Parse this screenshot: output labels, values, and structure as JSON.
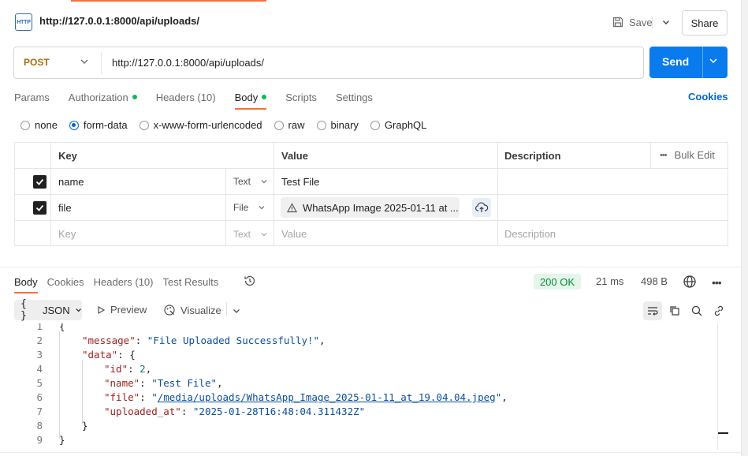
{
  "header": {
    "badge": "HTTP",
    "title": "http://127.0.0.1:8000/api/uploads/",
    "save_label": "Save",
    "share_label": "Share"
  },
  "request": {
    "method": "POST",
    "url": "http://127.0.0.1:8000/api/uploads/",
    "send_label": "Send",
    "tabs": [
      {
        "label": "Params"
      },
      {
        "label": "Authorization",
        "dot": true
      },
      {
        "label": "Headers (10)"
      },
      {
        "label": "Body",
        "dot": true,
        "active": true
      },
      {
        "label": "Scripts"
      },
      {
        "label": "Settings"
      }
    ],
    "cookies_label": "Cookies",
    "body_types": [
      "none",
      "form-data",
      "x-www-form-urlencoded",
      "raw",
      "binary",
      "GraphQL"
    ],
    "selected_body_type": "form-data"
  },
  "form_table": {
    "headers": {
      "key": "Key",
      "value": "Value",
      "description": "Description",
      "bulk_edit": "Bulk Edit"
    },
    "rows": [
      {
        "key": "name",
        "type": "Text",
        "value": "Test File",
        "checked": true
      },
      {
        "key": "file",
        "type": "File",
        "value": "WhatsApp Image 2025-01-11 at ...",
        "checked": true
      }
    ],
    "placeholder": {
      "key": "Key",
      "type": "Text",
      "value": "Value",
      "description": "Description"
    }
  },
  "response": {
    "tabs": [
      {
        "label": "Body",
        "active": true
      },
      {
        "label": "Cookies"
      },
      {
        "label": "Headers (10)"
      },
      {
        "label": "Test Results"
      }
    ],
    "status": "200 OK",
    "time": "21 ms",
    "size": "498 B",
    "format": "JSON",
    "preview_label": "Preview",
    "visualize_label": "Visualize",
    "lines": [
      "1",
      "2",
      "3",
      "4",
      "5",
      "6",
      "7",
      "8",
      "9"
    ],
    "json": {
      "open_brace": "{",
      "message_key": "\"message\"",
      "message_val": "\"File Uploaded Successfully!\"",
      "data_key": "\"data\"",
      "id_key": "\"id\"",
      "id_val": "2",
      "name_key": "\"name\"",
      "name_val": "\"Test File\"",
      "file_key": "\"file\"",
      "file_val": "/media/uploads/WhatsApp_Image_2025-01-11_at_19.04.04.jpeg",
      "uploaded_key": "\"uploaded_at\"",
      "uploaded_val": "\"2025-01-28T16:48:04.311432Z\"",
      "close_inner": "}",
      "close_brace": "}"
    }
  },
  "colors": {
    "accent": "#ff6c37",
    "send": "#097bed",
    "status_ok": "#0a8a3c",
    "method_post": "#b06a0b",
    "link": "#0265d2"
  }
}
